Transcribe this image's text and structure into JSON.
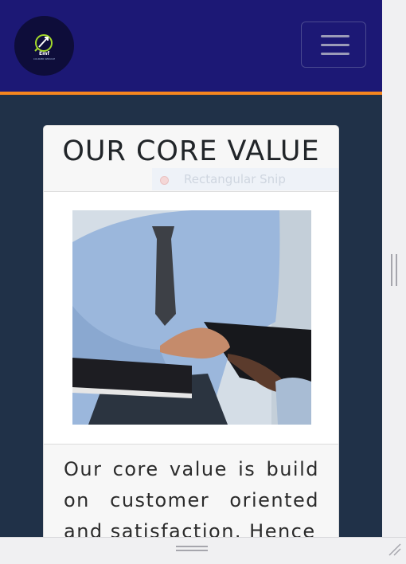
{
  "navbar": {
    "logo_text": "Emf",
    "logo_subtext": "COURIER SERVICE",
    "menu_icon": "hamburger-icon"
  },
  "card": {
    "title": "OUR CORE VALUE",
    "image_icon": "handshake-photo",
    "body_text": "Our core value is build on customer oriented and satisfaction. Hence"
  },
  "overlay": {
    "snip_label": "Rectangular Snip"
  },
  "colors": {
    "navbar_bg": "#1c1875",
    "accent_orange": "#f5861f",
    "page_bg": "#203148",
    "logo_green": "#a3d92b"
  }
}
